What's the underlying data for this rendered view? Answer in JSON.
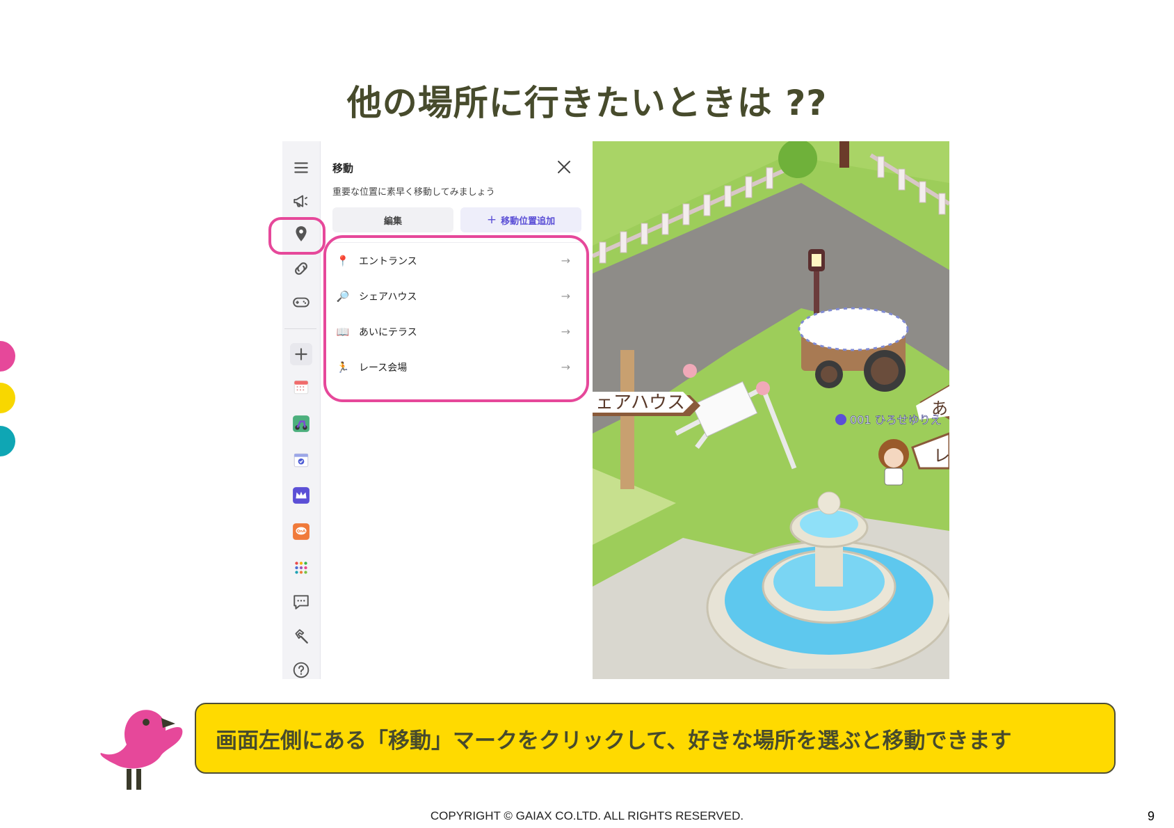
{
  "slide": {
    "title": "他の場所に行きたいときは ??",
    "instruction": "画面左側にある「移動」マークをクリックして、好きな場所を選ぶと移動できます",
    "copyright": "COPYRIGHT © GAIAX CO.LTD. ALL RIGHTS RESERVED.",
    "page_number": "9"
  },
  "colors": {
    "title": "#474b2c",
    "highlight": "#e6489a",
    "banner": "#ffda00",
    "accent_purple": "#5b4fd6",
    "dots": [
      "#e6489a",
      "#f8d700",
      "#0fa6b4"
    ]
  },
  "sidebar": {
    "icons": [
      "menu-icon",
      "megaphone-icon",
      "location-pin-icon",
      "link-icon",
      "gamepad-icon",
      "add-icon",
      "calendar-icon",
      "scooter-app-icon",
      "calendar-check-icon",
      "crown-icon",
      "qna-icon",
      "dots-grid-icon",
      "chat-icon",
      "hammer-icon",
      "help-icon"
    ]
  },
  "move_panel": {
    "title": "移動",
    "subtitle": "重要な位置に素早く移動してみましょう",
    "edit_button": "編集",
    "add_button": "移動位置追加",
    "locations": [
      {
        "icon": "📍",
        "label": "エントランス"
      },
      {
        "icon": "🔎",
        "label": "シェアハウス"
      },
      {
        "icon": "📖",
        "label": "あいにテラス"
      },
      {
        "icon": "🏃",
        "label": "レース会場"
      }
    ],
    "arrow": "→"
  },
  "game": {
    "sign_left": "ェアハウス",
    "sign_right_top": "あ",
    "sign_right_bottom": "レ",
    "player_name": "001 ひろせゆりえ"
  }
}
